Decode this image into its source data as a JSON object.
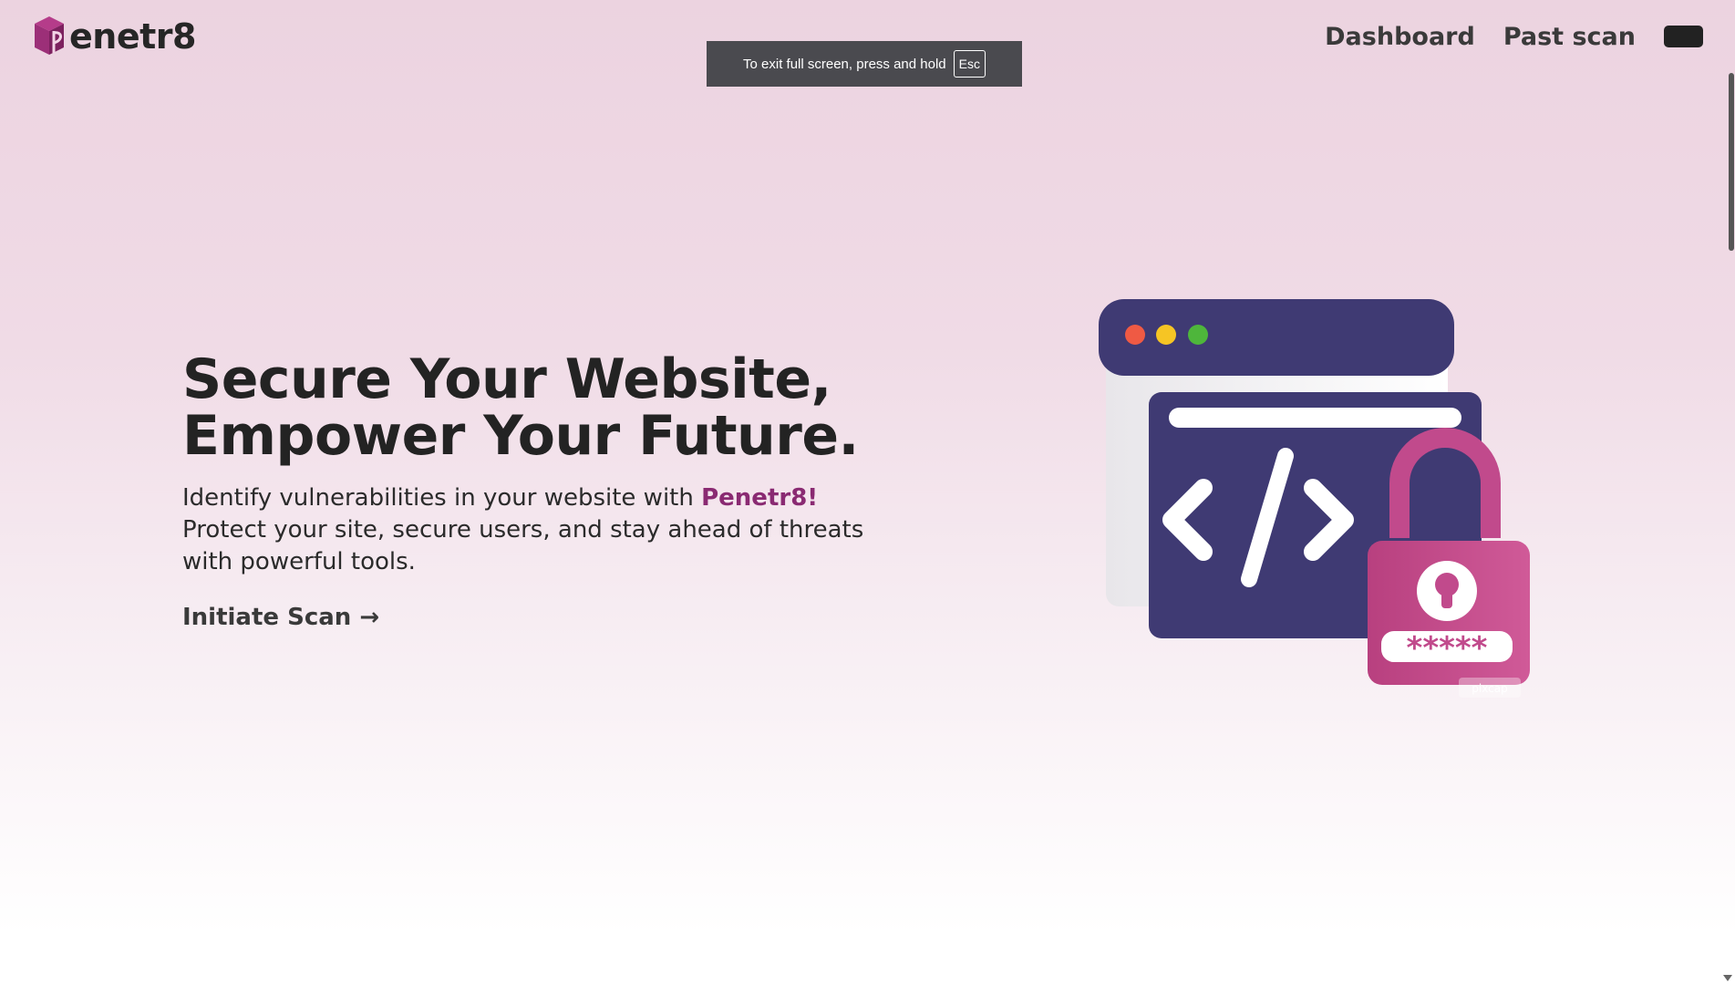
{
  "brand": {
    "name": "enetr8",
    "logo_icon": "box-p-logo-icon"
  },
  "nav": {
    "links": [
      "Dashboard",
      "Past scan"
    ],
    "menu_button": "dark-pill-button"
  },
  "fullscreen_notice": {
    "text": "To exit full screen, press and hold",
    "key": "Esc"
  },
  "hero": {
    "title_line1": "Secure Your Website,",
    "title_line2": "Empower Your Future.",
    "desc_prefix": "Identify vulnerabilities in your website with ",
    "desc_brand": "Penetr8!",
    "desc_suffix": "Protect your site, secure users, and stay ahead of threats with powerful tools.",
    "cta": "Initiate Scan →"
  },
  "illustration": {
    "icon": "code-window-lock-icon",
    "password_mask": "*****",
    "watermark": "pixcap"
  },
  "colors": {
    "accent": "#8a2a72",
    "navy": "#3f3a73",
    "pink": "#c14a8c"
  }
}
